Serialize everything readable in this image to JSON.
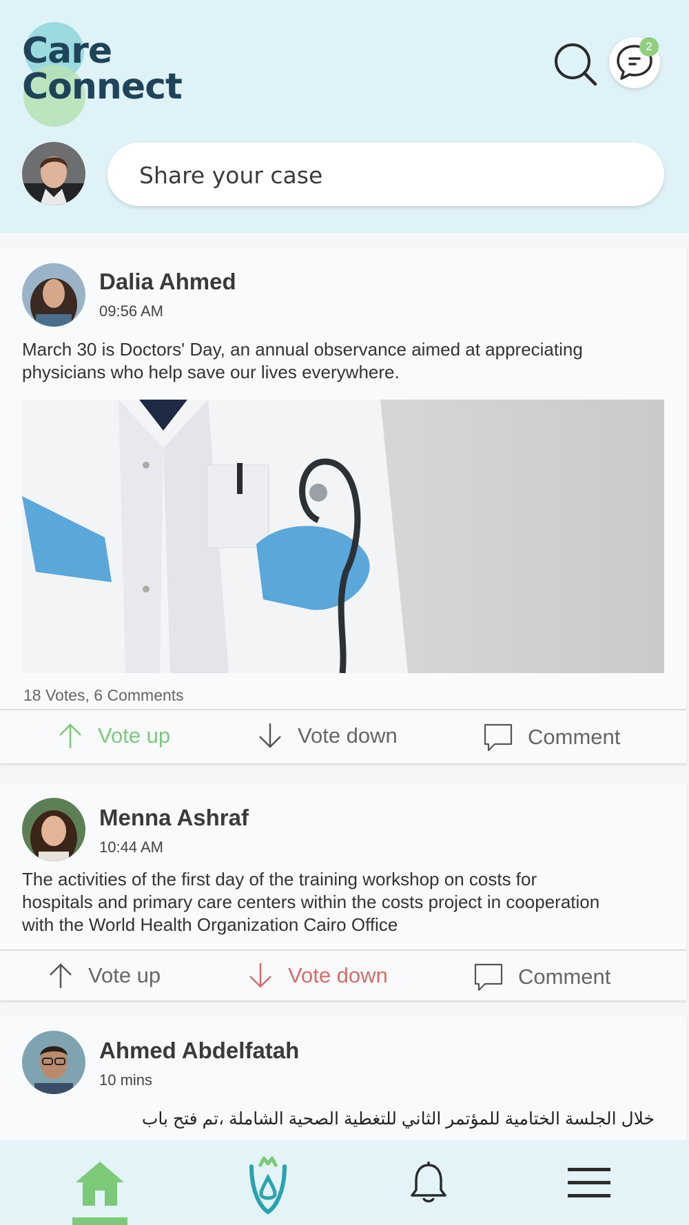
{
  "app": {
    "logo_line1": "Care",
    "logo_line2": "Connect",
    "messages_badge": "2",
    "share_placeholder": "Share your case"
  },
  "colors": {
    "header_bg": "#dff2f7",
    "accent_green": "#7cc97a",
    "accent_red": "#d86b6b",
    "logo_dark": "#1f4358"
  },
  "posts": [
    {
      "author": "Dalia Ahmed",
      "time": "09:56 AM",
      "text": "March 30 is Doctors' Day, an annual observance aimed at appreciating\nphysicians who help save our lives everywhere.",
      "stats": "18 Votes, 6 Comments",
      "actions": {
        "vote_up": "Vote up",
        "vote_down": "Vote down",
        "comment": "Comment"
      },
      "vote_state": "up"
    },
    {
      "author": "Menna Ashraf",
      "time": "10:44 AM",
      "text": "The activities of the first day of the training workshop on costs for\nhospitals and primary care centers within the costs project in cooperation\n with the World Health Organization Cairo Office",
      "actions": {
        "vote_up": "Vote up",
        "vote_down": "Vote down",
        "comment": "Comment"
      },
      "vote_state": "down"
    },
    {
      "author": "Ahmed Abdelfatah",
      "time": "10 mins",
      "text": "خلال الجلسة الختامية للمؤتمر الثاني للتغطية الصحية الشاملة ،تم فتح باب"
    }
  ],
  "nav": {
    "items": [
      "home-icon",
      "care-logo-icon",
      "bell-icon",
      "menu-icon"
    ],
    "active": "home-icon"
  }
}
